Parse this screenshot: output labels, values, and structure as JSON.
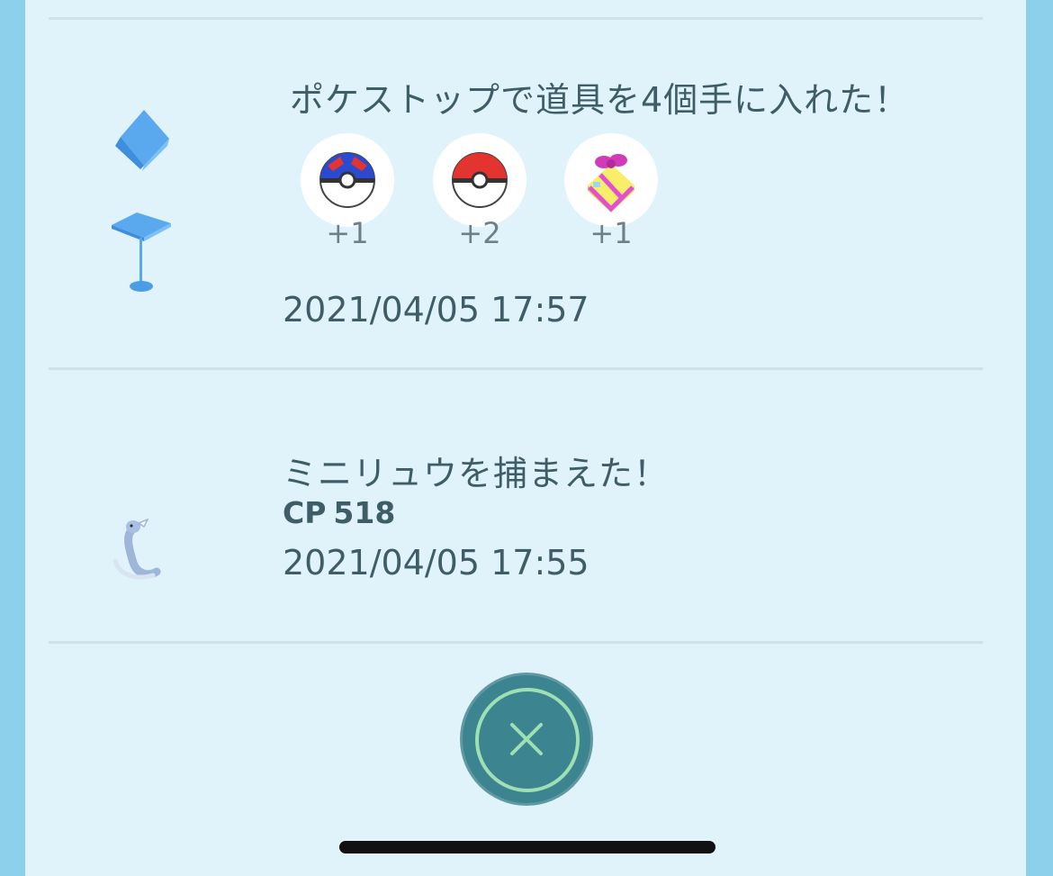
{
  "entries": [
    {
      "title": "ポケストップで道具を4個手に入れた！",
      "icon": "pokestop-icon",
      "items": [
        {
          "name": "great-ball-icon",
          "count": "+1"
        },
        {
          "name": "poke-ball-icon",
          "count": "+2"
        },
        {
          "name": "gift-icon",
          "count": "+1"
        }
      ],
      "timestamp": "2021/04/05 17:57"
    },
    {
      "title": "ミニリュウを捕まえた！",
      "icon": "dratini-icon",
      "cp_label": "CP",
      "cp_value": "518",
      "timestamp": "2021/04/05 17:55"
    }
  ],
  "close_button": {
    "icon": "close-icon"
  },
  "colors": {
    "background": "#8dd0ec",
    "panel": "#e0f3fb",
    "text": "#3f5d66",
    "close_button": "#3b8490",
    "close_ring": "#9ee0b4"
  }
}
